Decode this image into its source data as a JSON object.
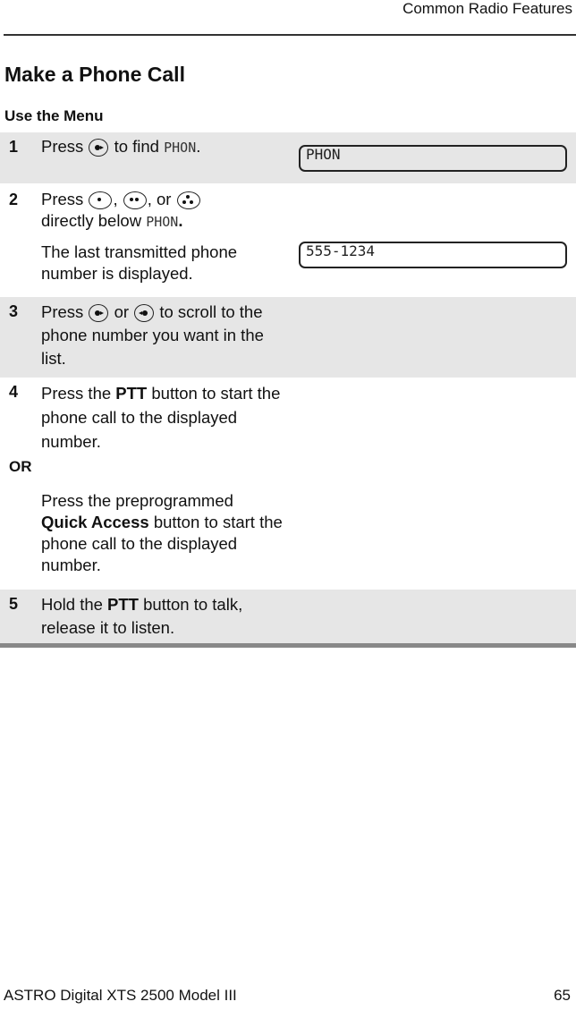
{
  "header": {
    "section": "Common Radio Features"
  },
  "title": "Make a Phone Call",
  "subtitle": "Use the Menu",
  "steps": [
    {
      "num": "1",
      "pre": "Press",
      "post": "to find",
      "mode": "PHON",
      "end": ".",
      "display": "PHON"
    },
    {
      "num": "2",
      "pre": "Press",
      "sep1": ",",
      "sep2": ", or",
      "line2": "directly below",
      "mode": "PHON",
      "end": ".",
      "para": "The last transmitted phone number is displayed.",
      "display": "555-1234"
    },
    {
      "num": "3",
      "pre": "Press",
      "mid": "or",
      "post": "to scroll to the phone number you want in the list."
    },
    {
      "num": "4",
      "pre": "Press the",
      "bold": "PTT",
      "post": "button to start the phone call to the displayed number.",
      "or": "OR",
      "alt_pre": "Press the preprogrammed",
      "alt_bold": "Quick Access",
      "alt_post": "button to start the phone call to the displayed number."
    },
    {
      "num": "5",
      "pre": "Hold the",
      "bold": "PTT",
      "post": "button to talk, release it to listen."
    }
  ],
  "icons": [
    "right-arrow-button-icon",
    "left-arrow-button-icon",
    "one-dot-button-icon",
    "two-dot-button-icon",
    "three-dot-button-icon"
  ],
  "footer": {
    "left": "ASTRO Digital XTS 2500 Model III",
    "page": "65"
  }
}
